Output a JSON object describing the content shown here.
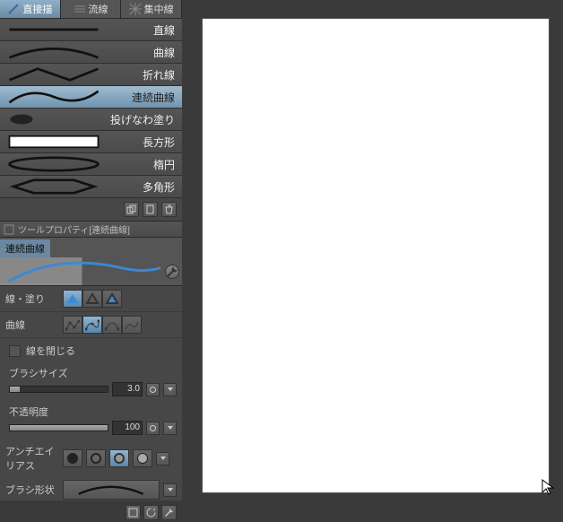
{
  "tabs": [
    {
      "label": "直接描",
      "active": true
    },
    {
      "label": "流線",
      "active": false
    },
    {
      "label": "集中線",
      "active": false
    }
  ],
  "tools": [
    {
      "label": "直線"
    },
    {
      "label": "曲線"
    },
    {
      "label": "折れ線"
    },
    {
      "label": "連続曲線",
      "selected": true
    },
    {
      "label": "投げなわ塗り"
    },
    {
      "label": "長方形"
    },
    {
      "label": "楕円"
    },
    {
      "label": "多角形"
    }
  ],
  "property_header": "ツールプロパティ[連続曲線]",
  "preset_name": "連続曲線",
  "props": {
    "line_fill_label": "線・塗り",
    "curve_label": "曲線",
    "close_line_label": "線を閉じる",
    "brush_size_label": "ブラシサイズ",
    "brush_size_value": "3.0",
    "opacity_label": "不透明度",
    "opacity_value": "100",
    "antialias_label": "アンチエイリアス",
    "brush_shape_label": "ブラシ形状"
  }
}
